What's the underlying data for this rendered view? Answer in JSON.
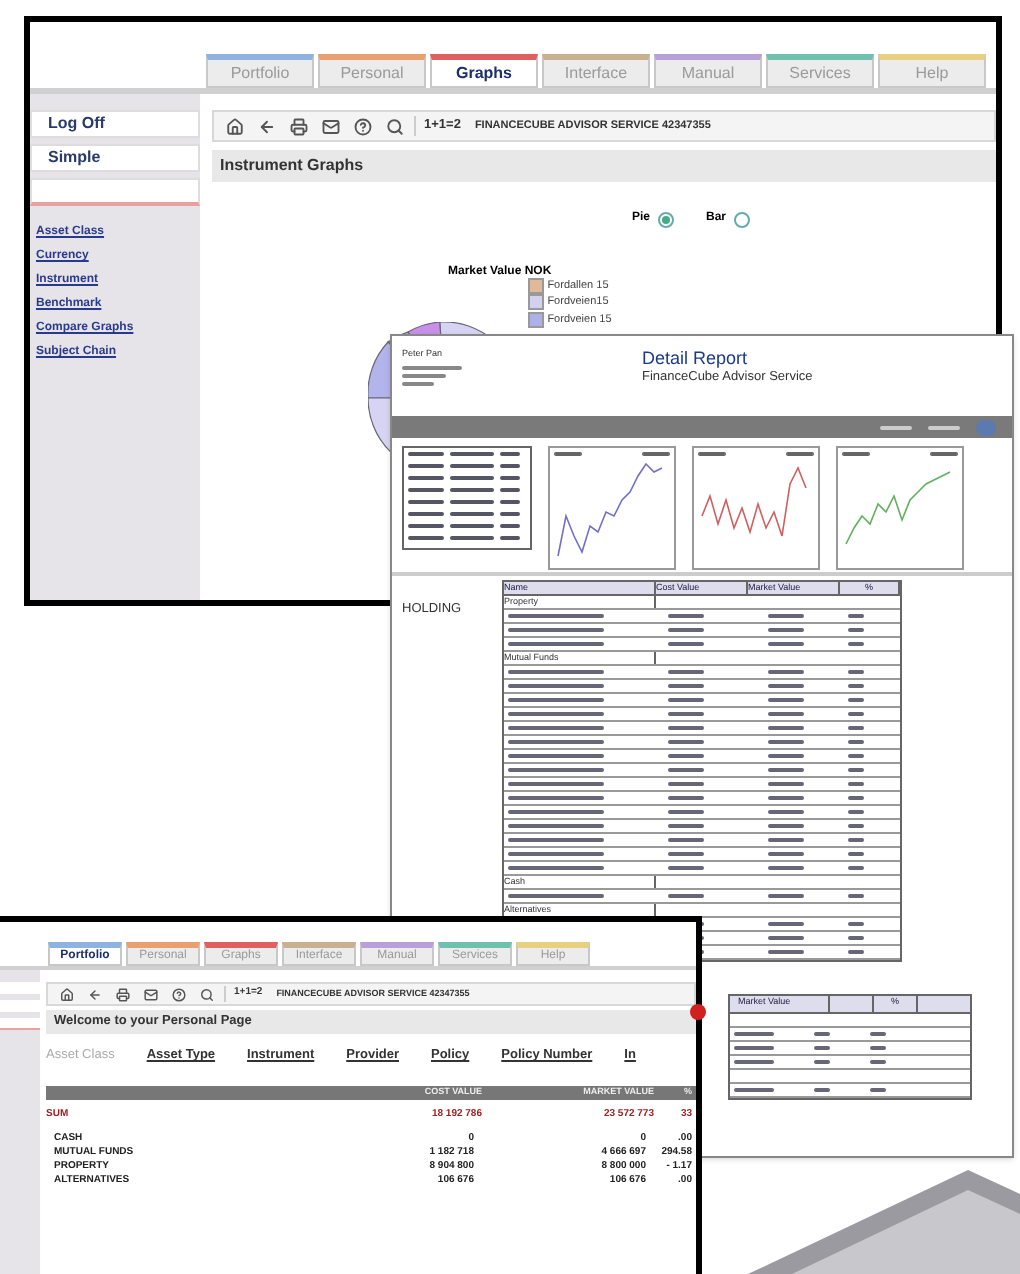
{
  "graphs_window": {
    "tabs": [
      {
        "label": "Portfolio",
        "selected": false,
        "color": "#8fb3e0"
      },
      {
        "label": "Personal",
        "selected": false,
        "color": "#e8a070"
      },
      {
        "label": "Graphs",
        "selected": true,
        "color": "#e06060"
      },
      {
        "label": "Interface",
        "selected": false,
        "color": "#c8b090"
      },
      {
        "label": "Manual",
        "selected": false,
        "color": "#b8a0d8"
      },
      {
        "label": "Services",
        "selected": false,
        "color": "#70c0b0"
      },
      {
        "label": "Help",
        "selected": false,
        "color": "#e8d080"
      }
    ],
    "sidebar_buttons": [
      "Log Off",
      "Simple"
    ],
    "sidebar_links": [
      "Asset Class",
      "Currency",
      "Instrument",
      "Benchmark",
      "Compare Graphs",
      "Subject Chain"
    ],
    "toolbar": {
      "formula": "1+1=2",
      "service": "FINANCECUBE ADVISOR SERVICE 42347355"
    },
    "title": "Instrument Graphs",
    "chart_types": [
      {
        "label": "Pie",
        "selected": true
      },
      {
        "label": "Bar",
        "selected": false
      }
    ],
    "chart_title": "Market Value NOK",
    "legend": [
      {
        "label": "Fordallen 15",
        "color": "#e0b89a"
      },
      {
        "label": "Fordveien15",
        "color": "#d4d0f0"
      },
      {
        "label": "Fordveien 15",
        "color": "#b0b0e8"
      }
    ]
  },
  "report_window": {
    "name": "Peter Pan",
    "title": "Detail Report",
    "subtitle": "FinanceCube Advisor Service",
    "section": "HOLDING",
    "columns": [
      "Name",
      "Cost Value",
      "Market Value",
      "%"
    ],
    "groups": [
      "Property",
      "Mutual Funds",
      "Cash",
      "Alternatives"
    ],
    "summary_columns": [
      "Market Value",
      "%"
    ]
  },
  "portfolio_window": {
    "tabs": [
      {
        "label": "Portfolio",
        "selected": true,
        "color": "#8fb3e0"
      },
      {
        "label": "Personal",
        "selected": false,
        "color": "#e8a070"
      },
      {
        "label": "Graphs",
        "selected": false,
        "color": "#e06060"
      },
      {
        "label": "Interface",
        "selected": false,
        "color": "#c8b090"
      },
      {
        "label": "Manual",
        "selected": false,
        "color": "#b8a0d8"
      },
      {
        "label": "Services",
        "selected": false,
        "color": "#70c0b0"
      },
      {
        "label": "Help",
        "selected": false,
        "color": "#e8d080"
      }
    ],
    "toolbar": {
      "formula": "1+1=2",
      "service": "FINANCECUBE ADVISOR SERVICE 42347355"
    },
    "title": "Welcome to your Personal Page",
    "filters": [
      {
        "label": "Asset Class",
        "selected": true
      },
      {
        "label": "Asset Type",
        "selected": false
      },
      {
        "label": "Instrument",
        "selected": false
      },
      {
        "label": "Provider",
        "selected": false
      },
      {
        "label": "Policy",
        "selected": false
      },
      {
        "label": "Policy Number",
        "selected": false
      },
      {
        "label": "In",
        "selected": false
      }
    ],
    "columns": [
      "COST VALUE",
      "MARKET VALUE",
      "%"
    ],
    "rows": [
      {
        "kind": "total",
        "label": "SUM",
        "cost": "18 192 786",
        "market": "23 572 773",
        "pct": "33"
      },
      {
        "kind": "item",
        "label": "CASH",
        "cost": "0",
        "market": "0",
        "pct": ".00"
      },
      {
        "kind": "item",
        "label": "MUTUAL FUNDS",
        "cost": "1 182 718",
        "market": "4 666 697",
        "pct": "294.58"
      },
      {
        "kind": "item",
        "label": "PROPERTY",
        "cost": "8 904 800",
        "market": "8 800 000",
        "pct": "- 1.17"
      },
      {
        "kind": "item",
        "label": "ALTERNATIVES",
        "cost": "106 676",
        "market": "106 676",
        "pct": ".00"
      }
    ]
  }
}
